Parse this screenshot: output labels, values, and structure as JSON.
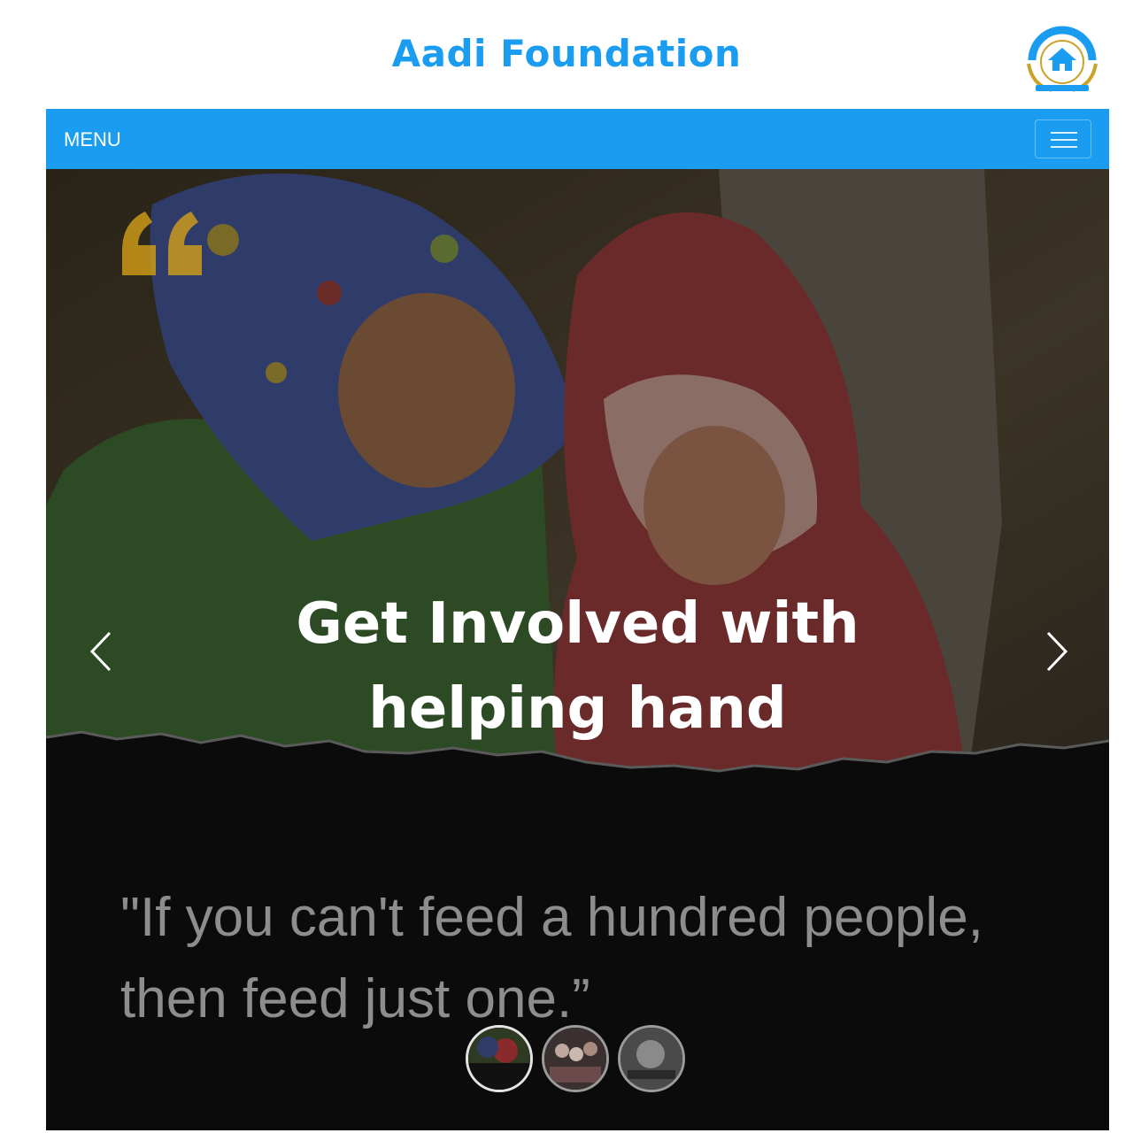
{
  "site": {
    "title": "Aadi Foundation",
    "title_color": "#1a9cf0",
    "logo": {
      "icon": "aadi-foundation-logo",
      "arc_text": "AADI FOUNDATION",
      "tagline": "Let's Bring a Change"
    }
  },
  "navbar": {
    "menu_label": "MENU",
    "background": "#1a9cf0",
    "toggle_icon": "hamburger-icon"
  },
  "hero": {
    "quote_icon": "quote-icon",
    "quote_icon_color": "#d4a017",
    "headline_line1": "Get Involved with",
    "headline_line2": "helping hand",
    "prev_icon": "chevron-left-icon",
    "next_icon": "chevron-right-icon",
    "quote_line1": "\"If you can't feed a hundred people,",
    "quote_line2": "then feed just one.”",
    "thumbnails": [
      {
        "name": "slide-1",
        "active": true
      },
      {
        "name": "slide-2",
        "active": false
      },
      {
        "name": "slide-3",
        "active": false
      }
    ]
  }
}
